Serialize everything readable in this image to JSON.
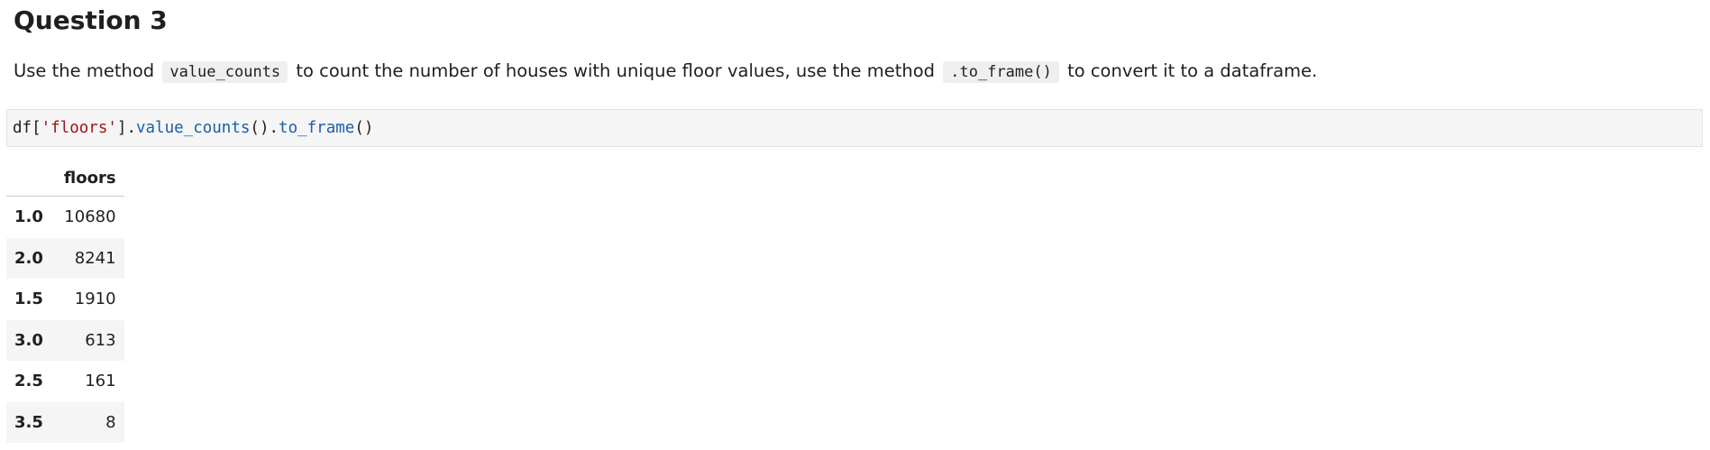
{
  "question": {
    "title": "Question 3",
    "text_parts": [
      "Use the method",
      "value_counts",
      "to count the number of houses with unique floor values, use the method",
      ".to_frame()",
      "to convert it to a dataframe."
    ]
  },
  "code_cell": {
    "tokens": [
      {
        "text": "df[",
        "kind": "plain"
      },
      {
        "text": "'floors'",
        "kind": "string"
      },
      {
        "text": "].",
        "kind": "plain"
      },
      {
        "text": "value_counts",
        "kind": "function"
      },
      {
        "text": "().",
        "kind": "plain"
      },
      {
        "text": "to_frame",
        "kind": "function"
      },
      {
        "text": "()",
        "kind": "plain"
      }
    ]
  },
  "output_table": {
    "index_header": "",
    "column_header": "floors",
    "rows": [
      {
        "index": "1.0",
        "value": "10680"
      },
      {
        "index": "2.0",
        "value": "8241"
      },
      {
        "index": "1.5",
        "value": "1910"
      },
      {
        "index": "3.0",
        "value": "613"
      },
      {
        "index": "2.5",
        "value": "161"
      },
      {
        "index": "3.5",
        "value": "8"
      }
    ]
  }
}
